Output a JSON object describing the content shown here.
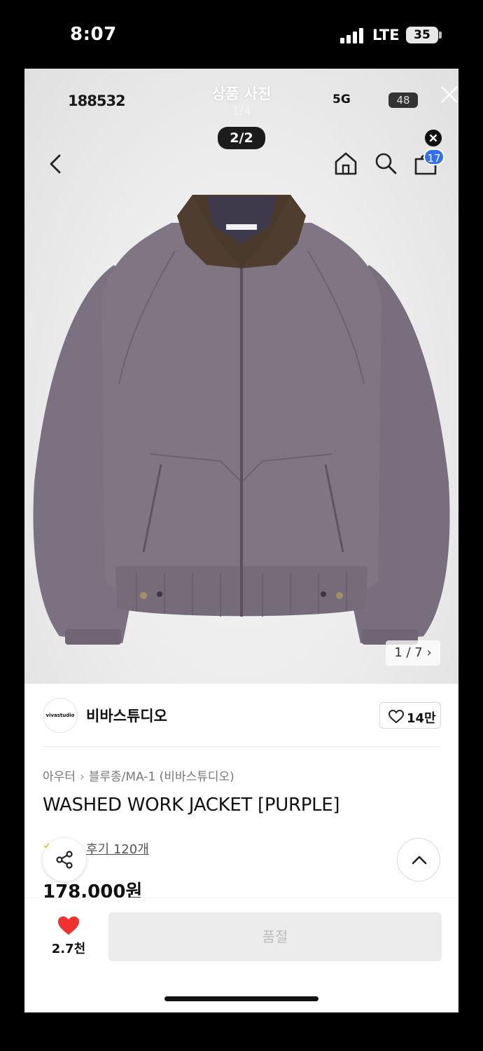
{
  "status_bar": {
    "time": "8:07",
    "network": "LTE",
    "battery": "35"
  },
  "viewer": {
    "inner_time": "188532",
    "inner_network": "5G",
    "inner_battery": "48",
    "title": "상품 사진",
    "counter": "1/4",
    "page_pill": "2/2",
    "cart_badge": "17",
    "image_counter": "1 / 7 ›"
  },
  "brand": {
    "logo_text": "vivastudio",
    "name": "비바스튜디오",
    "like_count": "14만"
  },
  "product": {
    "breadcrumb": [
      "아우터",
      "블루종/MA-1 (비바스튜디오)"
    ],
    "breadcrumb_sep": "›",
    "title": "WASHED WORK JACKET [PURPLE]",
    "review_link": "후기 120개",
    "price": "178,000원",
    "colors": {
      "body": "#7d7380",
      "collar": "#4a3a2c"
    }
  },
  "bottom_bar": {
    "wish_count": "2.7천",
    "soldout_label": "품절",
    "heart_color": "#f0312f"
  }
}
